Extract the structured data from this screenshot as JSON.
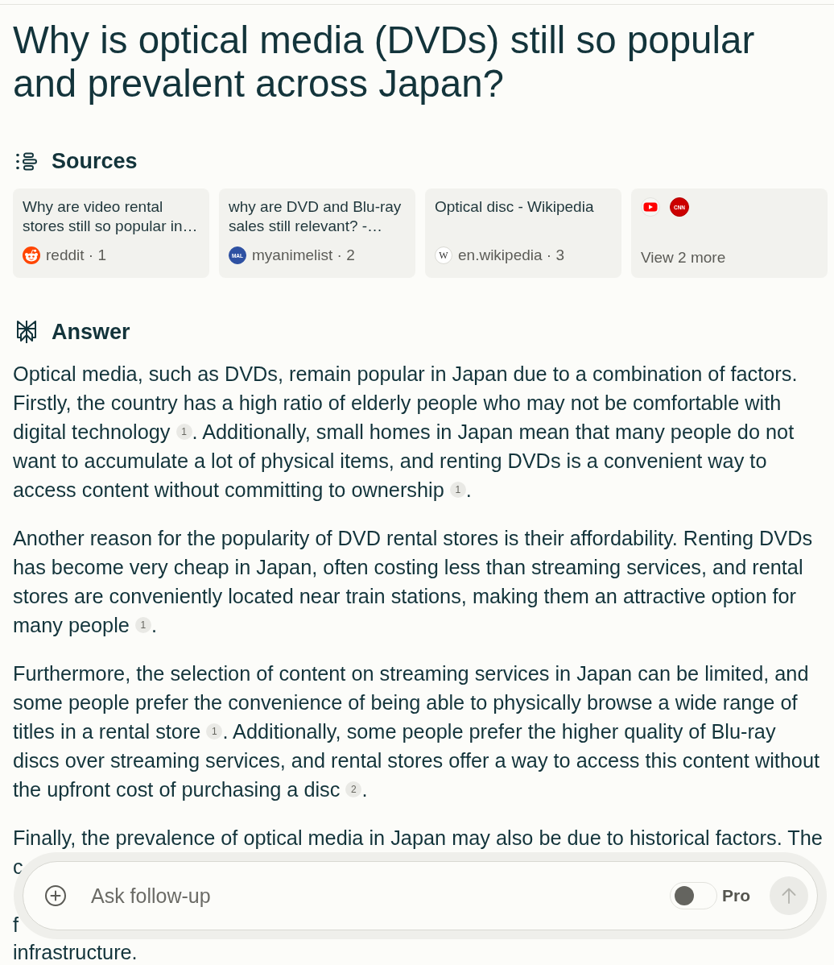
{
  "title": "Why is optical media (DVDs) still so popular and prevalent across Japan?",
  "sources": {
    "heading": "Sources",
    "cards": [
      {
        "kind": "source",
        "title": "Why are video rental stores still so popular in…",
        "meta": "reddit · 1"
      },
      {
        "kind": "source",
        "title": "why are DVD and Blu-ray sales still relevant? -…",
        "logo_text": "MAL",
        "meta": "myanimelist · 2"
      },
      {
        "kind": "source",
        "title": "Optical disc - Wikipedia",
        "logo_text": "W",
        "meta": "en.wikipedia · 3"
      },
      {
        "kind": "more",
        "logo_text": "CNN",
        "label": "View 2 more"
      }
    ]
  },
  "answer": {
    "heading": "Answer",
    "paragraphs": [
      {
        "parts": [
          {
            "kind": "text",
            "text": "Optical media, such as DVDs, remain popular in Japan due to a combination of factors. Firstly, the country has a high ratio of elderly people who may not be comfortable with digital technology "
          },
          {
            "kind": "citation",
            "text": "1"
          },
          {
            "kind": "text",
            "text": ". Additionally, small homes in Japan mean that many people do not want to accumulate a lot of physical items, and renting DVDs is a convenient way to access content without committing to ownership "
          },
          {
            "kind": "citation",
            "text": "1"
          },
          {
            "kind": "text",
            "text": "."
          }
        ]
      },
      {
        "parts": [
          {
            "kind": "text",
            "text": "Another reason for the popularity of DVD rental stores is their affordability. Renting DVDs has become very cheap in Japan, often costing less than streaming services, and rental stores are conveniently located near train stations, making them an attractive option for many people "
          },
          {
            "kind": "citation",
            "text": "1"
          },
          {
            "kind": "text",
            "text": "."
          }
        ]
      },
      {
        "parts": [
          {
            "kind": "text",
            "text": "Furthermore, the selection of content on streaming services in Japan can be limited, and some people prefer the convenience of being able to physically browse a wide range of titles in a rental store "
          },
          {
            "kind": "citation",
            "text": "1"
          },
          {
            "kind": "text",
            "text": ". Additionally, some people prefer the higher quality of Blu-ray discs over streaming services, and rental stores offer a way to access this content without the upfront cost of purchasing a disc "
          },
          {
            "kind": "citation",
            "text": "2"
          },
          {
            "kind": "text",
            "text": "."
          }
        ]
      }
    ],
    "covered_paragraph": {
      "first_line": "Finally, the prevalence of optical media in Japan may also be due to historical factors. The",
      "fragments": [
        "c",
        "f"
      ],
      "last_line": "infrastructure."
    }
  },
  "follow_up": {
    "placeholder": "Ask follow-up",
    "pro": {
      "label": "Pro",
      "on": false
    },
    "send": {
      "disabled": true
    }
  }
}
